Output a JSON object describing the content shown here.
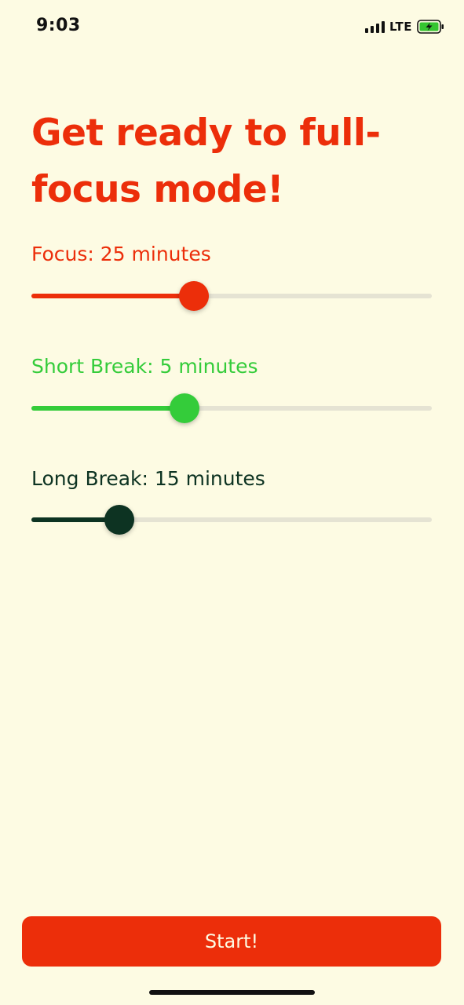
{
  "status_bar": {
    "time": "9:03",
    "network": "LTE",
    "icons": [
      "signal-icon",
      "battery-charging-icon"
    ]
  },
  "title": {
    "line1": "Get ready to full-",
    "line2": "focus mode!"
  },
  "settings": [
    {
      "label": "Focus: 25 minutes",
      "value": 25,
      "fill_fraction": 0.405,
      "color": "#EC2E0A"
    },
    {
      "label": "Short Break: 5 minutes",
      "value": 5,
      "fill_fraction": 0.383,
      "color": "#34CC3A"
    },
    {
      "label": "Long Break: 15 minutes",
      "value": 15,
      "fill_fraction": 0.22,
      "color": "#0D3322"
    }
  ],
  "start_button": {
    "label": "Start!"
  },
  "colors": {
    "background": "#FDFBE3",
    "accent": "#EC2E0A",
    "track": "#E5E3D3"
  }
}
